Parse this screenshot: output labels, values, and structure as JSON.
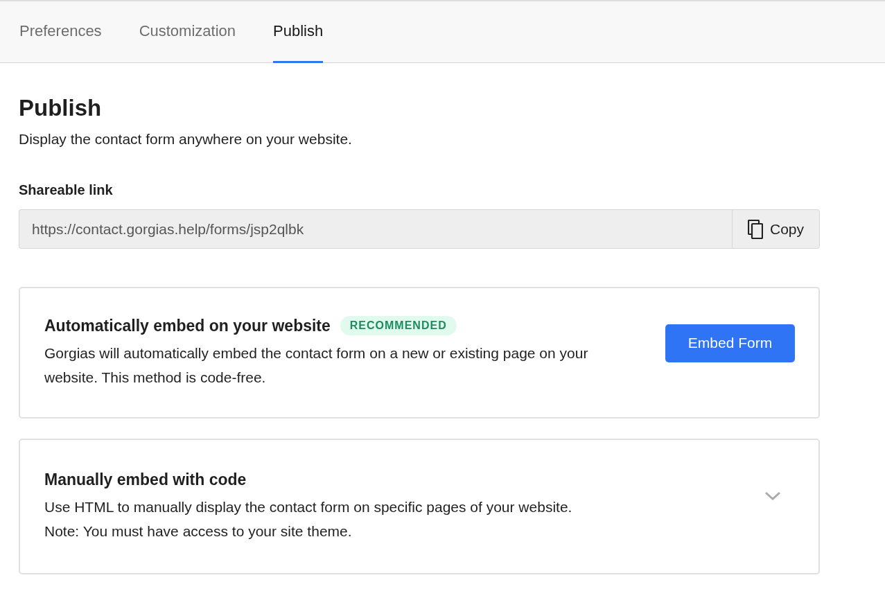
{
  "tabs": [
    {
      "label": "Preferences",
      "selected": false
    },
    {
      "label": "Customization",
      "selected": false
    },
    {
      "label": "Publish",
      "selected": true
    }
  ],
  "page": {
    "title": "Publish",
    "subtitle": "Display the contact form anywhere on your website."
  },
  "shareable_link": {
    "label": "Shareable link",
    "value": "https://contact.gorgias.help/forms/jsp2qlbk",
    "copy_button": "Copy"
  },
  "auto_embed": {
    "title": "Automatically embed on your website",
    "badge": "RECOMMENDED",
    "description": "Gorgias will automatically embed the contact form on a new or existing page on your website. This method is code-free.",
    "button": "Embed Form"
  },
  "manual_embed": {
    "title": "Manually embed with code",
    "description_lines": [
      "Use HTML to manually display the contact form on specific pages of your website.",
      "Note: You must have access to your site theme."
    ],
    "expanded": false
  }
}
